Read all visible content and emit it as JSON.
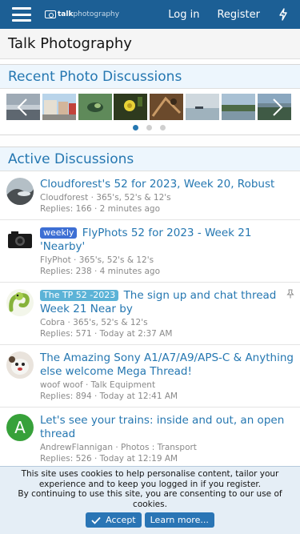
{
  "header": {
    "logo_bold": "talk",
    "logo_light": "photography",
    "login_label": "Log in",
    "register_label": "Register"
  },
  "page": {
    "title": "Talk Photography"
  },
  "recent": {
    "heading": "Recent Photo Discussions",
    "pages": 3,
    "active_page": 1
  },
  "active": {
    "heading": "Active Discussions",
    "threads": [
      {
        "prefix": "",
        "title": "Cloudforest's 52 for 2023, Week 20, Robust",
        "meta": "Cloudforest · 365's, 52's & 12's",
        "stats": "Replies: 166 · 2 minutes ago"
      },
      {
        "prefix": "weekly",
        "title": "FlyPhots 52 for 2023 - Week 21 'Nearby'",
        "meta": "FlyPhot · 365's, 52's & 12's",
        "stats": "Replies: 238 · 4 minutes ago"
      },
      {
        "prefix": "The TP 52 -2023",
        "title": "The sign up and chat thread Week 21 Near by",
        "meta": "Cobra · 365's, 52's & 12's",
        "stats": "Replies: 571 · Today at 2:37 AM"
      },
      {
        "prefix": "",
        "title": "The Amazing Sony A1/A7/A9/APS-C & Anything else welcome Mega Thread!",
        "meta": "woof woof · Talk Equipment",
        "stats": "Replies: 894 · Today at 12:41 AM"
      },
      {
        "prefix": "",
        "title": "Let's see your trains: inside and out, an open thread",
        "meta": "AndrewFlannigan · Photos : Transport",
        "stats": "Replies: 526 · Today at 12:19 AM",
        "avatar_letter": "A"
      }
    ]
  },
  "cookie": {
    "text_1": "This site uses cookies to help personalise content, tailor your experience and to keep you logged in if you register.",
    "text_2": "By continuing to use this site, you are consenting to our use of cookies.",
    "accept_label": "Accept",
    "learn_label": "Learn more..."
  },
  "colors": {
    "header_bg": "#1c5f95",
    "accent": "#2577b1",
    "block_head_bg": "#edf6fd"
  }
}
